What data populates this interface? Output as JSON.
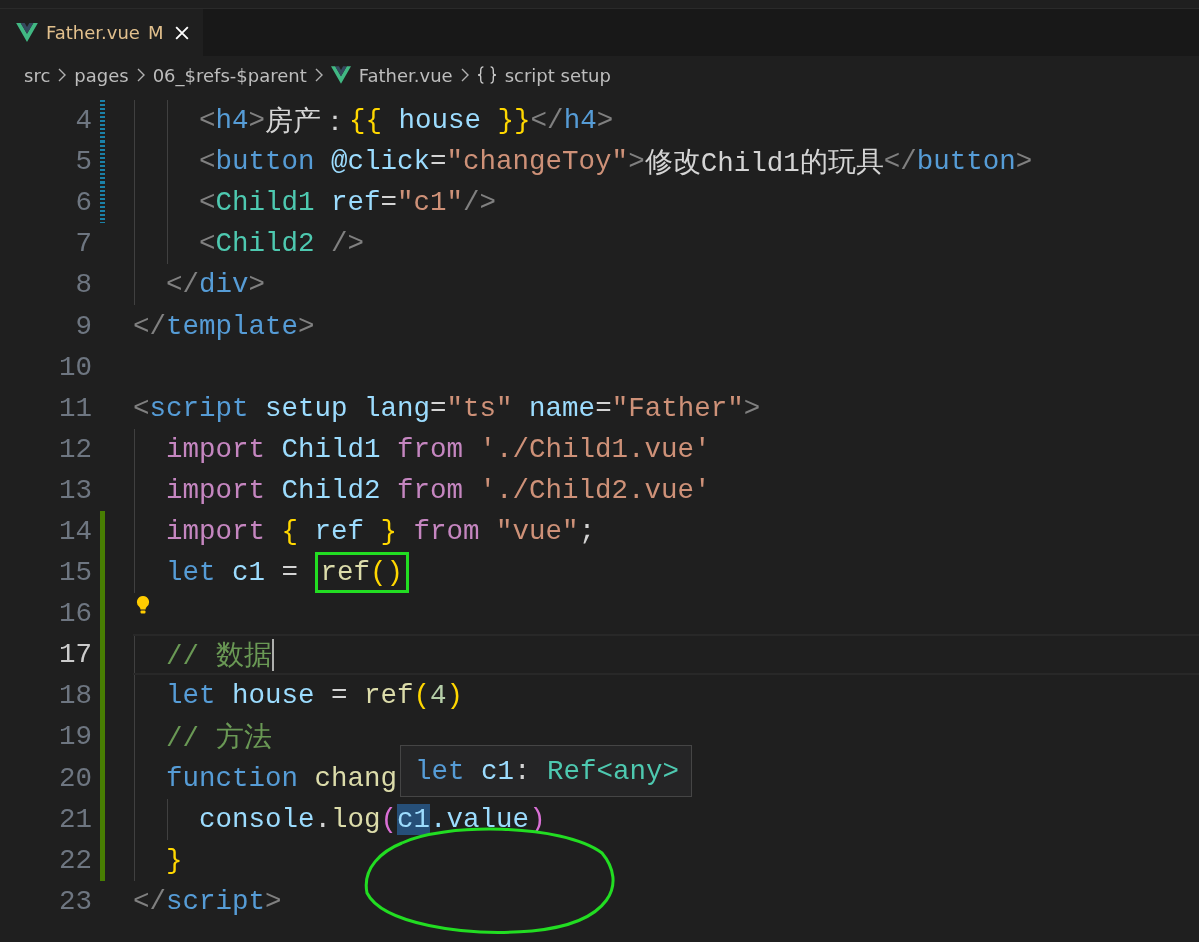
{
  "tabs": [
    {
      "label": "Father.vue",
      "status": "M",
      "selected": true
    }
  ],
  "breadcrumb": [
    {
      "label": "src",
      "kind": "folder"
    },
    {
      "label": "pages",
      "kind": "folder"
    },
    {
      "label": "06_$refs-$parent",
      "kind": "folder"
    },
    {
      "label": "Father.vue",
      "kind": "file"
    },
    {
      "label": "script setup",
      "kind": "symbol"
    }
  ],
  "lines": [
    {
      "number": "4",
      "modified": true,
      "added": false,
      "current": false,
      "tokens": [
        {
          "text": "    <",
          "kind": "punct"
        },
        {
          "text": "h4",
          "kind": "tag"
        },
        {
          "text": ">",
          "kind": "punct"
        },
        {
          "text": "房产：",
          "kind": "plain"
        },
        {
          "text": "{{",
          "kind": "brace"
        },
        {
          "text": " house ",
          "kind": "var"
        },
        {
          "text": "}}",
          "kind": "brace"
        },
        {
          "text": "</",
          "kind": "punct"
        },
        {
          "text": "h4",
          "kind": "tag"
        },
        {
          "text": ">",
          "kind": "punct"
        }
      ]
    },
    {
      "number": "5",
      "modified": true,
      "added": false,
      "current": false,
      "tokens": [
        {
          "text": "    <",
          "kind": "punct"
        },
        {
          "text": "button",
          "kind": "tag"
        },
        {
          "text": " @click",
          "kind": "attr"
        },
        {
          "text": "=",
          "kind": "plain"
        },
        {
          "text": "\"changeToy\"",
          "kind": "str"
        },
        {
          "text": ">",
          "kind": "punct"
        },
        {
          "text": "修改Child1的玩具",
          "kind": "plain"
        },
        {
          "text": "</",
          "kind": "punct"
        },
        {
          "text": "button",
          "kind": "tag"
        },
        {
          "text": ">",
          "kind": "punct"
        }
      ]
    },
    {
      "number": "6",
      "modified": true,
      "added": false,
      "current": false,
      "tokens": [
        {
          "text": "    <",
          "kind": "punct"
        },
        {
          "text": "Child1",
          "kind": "comp"
        },
        {
          "text": " ref",
          "kind": "attr"
        },
        {
          "text": "=",
          "kind": "plain"
        },
        {
          "text": "\"c1\"",
          "kind": "str"
        },
        {
          "text": "/>",
          "kind": "punct"
        }
      ]
    },
    {
      "number": "7",
      "modified": false,
      "added": false,
      "current": false,
      "tokens": [
        {
          "text": "    <",
          "kind": "punct"
        },
        {
          "text": "Child2",
          "kind": "comp"
        },
        {
          "text": " />",
          "kind": "punct"
        }
      ]
    },
    {
      "number": "8",
      "modified": false,
      "added": false,
      "current": false,
      "tokens": [
        {
          "text": "  </",
          "kind": "punct"
        },
        {
          "text": "div",
          "kind": "tag"
        },
        {
          "text": ">",
          "kind": "punct"
        }
      ]
    },
    {
      "number": "9",
      "modified": false,
      "added": false,
      "current": false,
      "tokens": [
        {
          "text": "</",
          "kind": "punct"
        },
        {
          "text": "template",
          "kind": "tag"
        },
        {
          "text": ">",
          "kind": "punct"
        }
      ]
    },
    {
      "number": "10",
      "modified": false,
      "added": false,
      "current": false
    },
    {
      "number": "11",
      "modified": false,
      "added": false,
      "current": false,
      "tokens": [
        {
          "text": "<",
          "kind": "punct"
        },
        {
          "text": "script",
          "kind": "tag"
        },
        {
          "text": " setup lang",
          "kind": "attr"
        },
        {
          "text": "=",
          "kind": "plain"
        },
        {
          "text": "\"ts\"",
          "kind": "str"
        },
        {
          "text": " name",
          "kind": "attr"
        },
        {
          "text": "=",
          "kind": "plain"
        },
        {
          "text": "\"Father\"",
          "kind": "str"
        },
        {
          "text": ">",
          "kind": "punct"
        }
      ]
    },
    {
      "number": "12",
      "modified": false,
      "added": false,
      "current": false,
      "tokens": [
        {
          "text": "  import",
          "kind": "kw"
        },
        {
          "text": " Child1 ",
          "kind": "var"
        },
        {
          "text": "from",
          "kind": "kw"
        },
        {
          "text": " './Child1.vue'",
          "kind": "str"
        }
      ]
    },
    {
      "number": "13",
      "modified": false,
      "added": false,
      "current": false,
      "tokens": [
        {
          "text": "  import",
          "kind": "kw"
        },
        {
          "text": " Child2 ",
          "kind": "var"
        },
        {
          "text": "from",
          "kind": "kw"
        },
        {
          "text": " './Child2.vue'",
          "kind": "str"
        }
      ]
    },
    {
      "number": "14",
      "modified": false,
      "added": true,
      "current": false,
      "tokens": [
        {
          "text": "  import",
          "kind": "kw"
        },
        {
          "text": " {",
          "kind": "brace"
        },
        {
          "text": " ref ",
          "kind": "var"
        },
        {
          "text": "}",
          "kind": "brace"
        },
        {
          "text": " from",
          "kind": "kw"
        },
        {
          "text": " \"vue\"",
          "kind": "str"
        },
        {
          "text": ";",
          "kind": "plain"
        }
      ]
    },
    {
      "number": "15",
      "modified": false,
      "added": true,
      "current": false,
      "tokens": [
        {
          "text": "  let",
          "kind": "decl"
        },
        {
          "text": " c1 ",
          "kind": "var"
        },
        {
          "text": "= ",
          "kind": "plain"
        },
        {
          "text": "ref",
          "kind": "fn",
          "boxed": true
        },
        {
          "text": "()",
          "kind": "brace",
          "boxed": true
        }
      ]
    },
    {
      "number": "16",
      "modified": false,
      "added": true,
      "current": false,
      "lightbulb": true
    },
    {
      "number": "17",
      "modified": false,
      "added": true,
      "current": true,
      "tokens": [
        {
          "text": "  // 数据",
          "kind": "com"
        }
      ]
    },
    {
      "number": "18",
      "modified": false,
      "added": true,
      "current": false,
      "tokens": [
        {
          "text": "  let",
          "kind": "decl"
        },
        {
          "text": " house ",
          "kind": "var"
        },
        {
          "text": "=",
          "kind": "plain"
        },
        {
          "text": " ref",
          "kind": "fn"
        },
        {
          "text": "(",
          "kind": "brace"
        },
        {
          "text": "4",
          "kind": "num"
        },
        {
          "text": ")",
          "kind": "brace"
        }
      ]
    },
    {
      "number": "19",
      "modified": false,
      "added": true,
      "current": false,
      "tokens": [
        {
          "text": "  // 方法",
          "kind": "com"
        }
      ]
    },
    {
      "number": "20",
      "modified": false,
      "added": true,
      "current": false,
      "tokens": [
        {
          "text": "  function",
          "kind": "decl"
        },
        {
          "text": " chang",
          "kind": "fn"
        }
      ]
    },
    {
      "number": "21",
      "modified": false,
      "added": true,
      "current": false,
      "tokens": [
        {
          "text": "    console",
          "kind": "var"
        },
        {
          "text": ".",
          "kind": "plain"
        },
        {
          "text": "log",
          "kind": "fn"
        },
        {
          "text": "(",
          "kind": "paren"
        },
        {
          "text": "c1",
          "kind": "var",
          "highlight": true
        },
        {
          "text": ".value",
          "kind": "var"
        },
        {
          "text": ")",
          "kind": "paren"
        }
      ]
    },
    {
      "number": "22",
      "modified": false,
      "added": true,
      "current": false,
      "tokens": [
        {
          "text": "  }",
          "kind": "brace"
        }
      ]
    },
    {
      "number": "23",
      "modified": false,
      "added": false,
      "current": false,
      "tokens": [
        {
          "text": "</",
          "kind": "punct"
        },
        {
          "text": "script",
          "kind": "tag"
        },
        {
          "text": ">",
          "kind": "punct"
        }
      ]
    }
  ],
  "hover": {
    "tokens": [
      {
        "text": "let",
        "kind": "decl"
      },
      {
        "text": " c1",
        "kind": "var"
      },
      {
        "text": ": ",
        "kind": "plain"
      },
      {
        "text": "Ref",
        "kind": "comp"
      },
      {
        "text": "<any>",
        "kind": "comp"
      }
    ]
  }
}
